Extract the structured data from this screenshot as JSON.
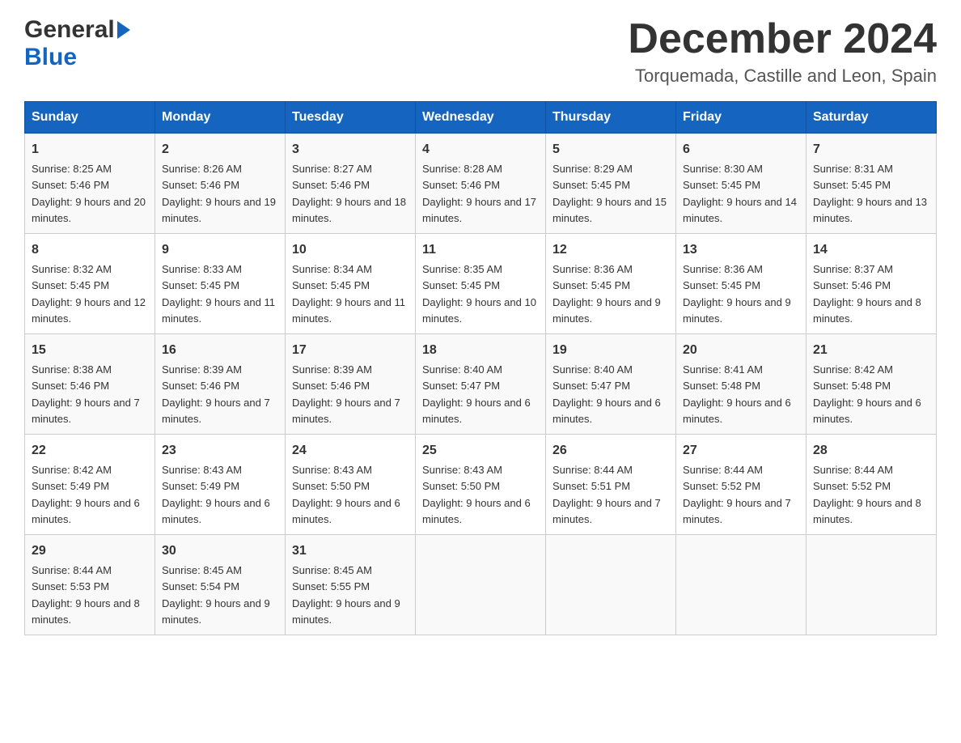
{
  "header": {
    "logo_general": "General",
    "logo_blue": "Blue",
    "month_title": "December 2024",
    "location": "Torquemada, Castille and Leon, Spain"
  },
  "days_of_week": [
    "Sunday",
    "Monday",
    "Tuesday",
    "Wednesday",
    "Thursday",
    "Friday",
    "Saturday"
  ],
  "weeks": [
    [
      {
        "day": "1",
        "sunrise": "8:25 AM",
        "sunset": "5:46 PM",
        "daylight": "9 hours and 20 minutes."
      },
      {
        "day": "2",
        "sunrise": "8:26 AM",
        "sunset": "5:46 PM",
        "daylight": "9 hours and 19 minutes."
      },
      {
        "day": "3",
        "sunrise": "8:27 AM",
        "sunset": "5:46 PM",
        "daylight": "9 hours and 18 minutes."
      },
      {
        "day": "4",
        "sunrise": "8:28 AM",
        "sunset": "5:46 PM",
        "daylight": "9 hours and 17 minutes."
      },
      {
        "day": "5",
        "sunrise": "8:29 AM",
        "sunset": "5:45 PM",
        "daylight": "9 hours and 15 minutes."
      },
      {
        "day": "6",
        "sunrise": "8:30 AM",
        "sunset": "5:45 PM",
        "daylight": "9 hours and 14 minutes."
      },
      {
        "day": "7",
        "sunrise": "8:31 AM",
        "sunset": "5:45 PM",
        "daylight": "9 hours and 13 minutes."
      }
    ],
    [
      {
        "day": "8",
        "sunrise": "8:32 AM",
        "sunset": "5:45 PM",
        "daylight": "9 hours and 12 minutes."
      },
      {
        "day": "9",
        "sunrise": "8:33 AM",
        "sunset": "5:45 PM",
        "daylight": "9 hours and 11 minutes."
      },
      {
        "day": "10",
        "sunrise": "8:34 AM",
        "sunset": "5:45 PM",
        "daylight": "9 hours and 11 minutes."
      },
      {
        "day": "11",
        "sunrise": "8:35 AM",
        "sunset": "5:45 PM",
        "daylight": "9 hours and 10 minutes."
      },
      {
        "day": "12",
        "sunrise": "8:36 AM",
        "sunset": "5:45 PM",
        "daylight": "9 hours and 9 minutes."
      },
      {
        "day": "13",
        "sunrise": "8:36 AM",
        "sunset": "5:45 PM",
        "daylight": "9 hours and 9 minutes."
      },
      {
        "day": "14",
        "sunrise": "8:37 AM",
        "sunset": "5:46 PM",
        "daylight": "9 hours and 8 minutes."
      }
    ],
    [
      {
        "day": "15",
        "sunrise": "8:38 AM",
        "sunset": "5:46 PM",
        "daylight": "9 hours and 7 minutes."
      },
      {
        "day": "16",
        "sunrise": "8:39 AM",
        "sunset": "5:46 PM",
        "daylight": "9 hours and 7 minutes."
      },
      {
        "day": "17",
        "sunrise": "8:39 AM",
        "sunset": "5:46 PM",
        "daylight": "9 hours and 7 minutes."
      },
      {
        "day": "18",
        "sunrise": "8:40 AM",
        "sunset": "5:47 PM",
        "daylight": "9 hours and 6 minutes."
      },
      {
        "day": "19",
        "sunrise": "8:40 AM",
        "sunset": "5:47 PM",
        "daylight": "9 hours and 6 minutes."
      },
      {
        "day": "20",
        "sunrise": "8:41 AM",
        "sunset": "5:48 PM",
        "daylight": "9 hours and 6 minutes."
      },
      {
        "day": "21",
        "sunrise": "8:42 AM",
        "sunset": "5:48 PM",
        "daylight": "9 hours and 6 minutes."
      }
    ],
    [
      {
        "day": "22",
        "sunrise": "8:42 AM",
        "sunset": "5:49 PM",
        "daylight": "9 hours and 6 minutes."
      },
      {
        "day": "23",
        "sunrise": "8:43 AM",
        "sunset": "5:49 PM",
        "daylight": "9 hours and 6 minutes."
      },
      {
        "day": "24",
        "sunrise": "8:43 AM",
        "sunset": "5:50 PM",
        "daylight": "9 hours and 6 minutes."
      },
      {
        "day": "25",
        "sunrise": "8:43 AM",
        "sunset": "5:50 PM",
        "daylight": "9 hours and 6 minutes."
      },
      {
        "day": "26",
        "sunrise": "8:44 AM",
        "sunset": "5:51 PM",
        "daylight": "9 hours and 7 minutes."
      },
      {
        "day": "27",
        "sunrise": "8:44 AM",
        "sunset": "5:52 PM",
        "daylight": "9 hours and 7 minutes."
      },
      {
        "day": "28",
        "sunrise": "8:44 AM",
        "sunset": "5:52 PM",
        "daylight": "9 hours and 8 minutes."
      }
    ],
    [
      {
        "day": "29",
        "sunrise": "8:44 AM",
        "sunset": "5:53 PM",
        "daylight": "9 hours and 8 minutes."
      },
      {
        "day": "30",
        "sunrise": "8:45 AM",
        "sunset": "5:54 PM",
        "daylight": "9 hours and 9 minutes."
      },
      {
        "day": "31",
        "sunrise": "8:45 AM",
        "sunset": "5:55 PM",
        "daylight": "9 hours and 9 minutes."
      },
      null,
      null,
      null,
      null
    ]
  ]
}
